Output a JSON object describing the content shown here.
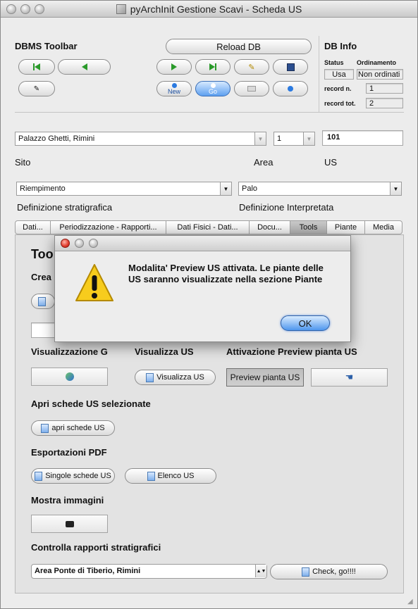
{
  "window": {
    "title": "pyArchInit Gestione Scavi - Scheda US",
    "title_icon": "app-icon"
  },
  "toolbar": {
    "label": "DBMS Toolbar",
    "reload": "Reload DB",
    "new": "New",
    "go": "Go"
  },
  "db_info": {
    "label": "DB Info",
    "status_label": "Status",
    "status_value": "Usa",
    "ord_label": "Ordinamento",
    "ord_value": "Non ordinati",
    "record_n_label": "record n.",
    "record_n_value": "1",
    "record_tot_label": "record tot.",
    "record_tot_value": "2"
  },
  "fields": {
    "sito_value": "Palazzo Ghetti, Rimini",
    "area_value": "1",
    "us_value": "101",
    "sito_label": "Sito",
    "area_label": "Area",
    "us_label": "US",
    "def_strat_value": "Riempimento",
    "def_strat_label": "Definizione stratigrafica",
    "def_interp_value": "Palo",
    "def_interp_label": "Definizione Interpretata"
  },
  "tabs": [
    "Dati...",
    "Periodizzazione - Rapporti...",
    "Dati Fisici - Dati...",
    "Docu...",
    "Tools",
    "Piante",
    "Media"
  ],
  "tools": {
    "title_partial": "Too",
    "crea_partial": "Crea",
    "vis_g_label": "Visualizzazione G",
    "vis_us_label": "Visualizza US",
    "preview_label": "Attivazione Preview pianta US",
    "vis_us_button": "Visualizza US",
    "preview_button": "Preview pianta US",
    "apri_label": "Apri schede US selezionate",
    "apri_button": "apri schede US",
    "pdf_label": "Esportazioni PDF",
    "pdf_singole": "Singole schede US",
    "pdf_elenco": "Elenco US",
    "img_label": "Mostra immagini",
    "rapporti_label": "Controlla rapporti stratigrafici",
    "rapporti_value": "Area Ponte di Tiberio, Rimini",
    "check_button": "Check, go!!!!"
  },
  "dialog": {
    "message": "Modalita' Preview US attivata. Le piante delle US saranno visualizzate nella sezione Piante",
    "ok": "OK",
    "icon": "warning-icon"
  }
}
